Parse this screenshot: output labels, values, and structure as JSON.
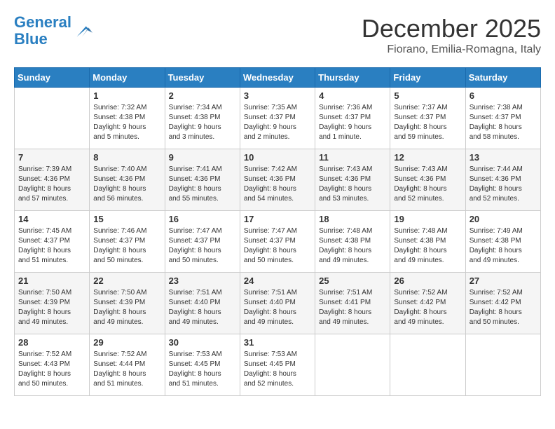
{
  "logo": {
    "line1": "General",
    "line2": "Blue"
  },
  "title": "December 2025",
  "location": "Fiorano, Emilia-Romagna, Italy",
  "header_days": [
    "Sunday",
    "Monday",
    "Tuesday",
    "Wednesday",
    "Thursday",
    "Friday",
    "Saturday"
  ],
  "weeks": [
    [
      {
        "day": "",
        "info": ""
      },
      {
        "day": "1",
        "info": "Sunrise: 7:32 AM\nSunset: 4:38 PM\nDaylight: 9 hours\nand 5 minutes."
      },
      {
        "day": "2",
        "info": "Sunrise: 7:34 AM\nSunset: 4:38 PM\nDaylight: 9 hours\nand 3 minutes."
      },
      {
        "day": "3",
        "info": "Sunrise: 7:35 AM\nSunset: 4:37 PM\nDaylight: 9 hours\nand 2 minutes."
      },
      {
        "day": "4",
        "info": "Sunrise: 7:36 AM\nSunset: 4:37 PM\nDaylight: 9 hours\nand 1 minute."
      },
      {
        "day": "5",
        "info": "Sunrise: 7:37 AM\nSunset: 4:37 PM\nDaylight: 8 hours\nand 59 minutes."
      },
      {
        "day": "6",
        "info": "Sunrise: 7:38 AM\nSunset: 4:37 PM\nDaylight: 8 hours\nand 58 minutes."
      }
    ],
    [
      {
        "day": "7",
        "info": "Sunrise: 7:39 AM\nSunset: 4:36 PM\nDaylight: 8 hours\nand 57 minutes."
      },
      {
        "day": "8",
        "info": "Sunrise: 7:40 AM\nSunset: 4:36 PM\nDaylight: 8 hours\nand 56 minutes."
      },
      {
        "day": "9",
        "info": "Sunrise: 7:41 AM\nSunset: 4:36 PM\nDaylight: 8 hours\nand 55 minutes."
      },
      {
        "day": "10",
        "info": "Sunrise: 7:42 AM\nSunset: 4:36 PM\nDaylight: 8 hours\nand 54 minutes."
      },
      {
        "day": "11",
        "info": "Sunrise: 7:43 AM\nSunset: 4:36 PM\nDaylight: 8 hours\nand 53 minutes."
      },
      {
        "day": "12",
        "info": "Sunrise: 7:43 AM\nSunset: 4:36 PM\nDaylight: 8 hours\nand 52 minutes."
      },
      {
        "day": "13",
        "info": "Sunrise: 7:44 AM\nSunset: 4:36 PM\nDaylight: 8 hours\nand 52 minutes."
      }
    ],
    [
      {
        "day": "14",
        "info": "Sunrise: 7:45 AM\nSunset: 4:37 PM\nDaylight: 8 hours\nand 51 minutes."
      },
      {
        "day": "15",
        "info": "Sunrise: 7:46 AM\nSunset: 4:37 PM\nDaylight: 8 hours\nand 50 minutes."
      },
      {
        "day": "16",
        "info": "Sunrise: 7:47 AM\nSunset: 4:37 PM\nDaylight: 8 hours\nand 50 minutes."
      },
      {
        "day": "17",
        "info": "Sunrise: 7:47 AM\nSunset: 4:37 PM\nDaylight: 8 hours\nand 50 minutes."
      },
      {
        "day": "18",
        "info": "Sunrise: 7:48 AM\nSunset: 4:38 PM\nDaylight: 8 hours\nand 49 minutes."
      },
      {
        "day": "19",
        "info": "Sunrise: 7:48 AM\nSunset: 4:38 PM\nDaylight: 8 hours\nand 49 minutes."
      },
      {
        "day": "20",
        "info": "Sunrise: 7:49 AM\nSunset: 4:38 PM\nDaylight: 8 hours\nand 49 minutes."
      }
    ],
    [
      {
        "day": "21",
        "info": "Sunrise: 7:50 AM\nSunset: 4:39 PM\nDaylight: 8 hours\nand 49 minutes."
      },
      {
        "day": "22",
        "info": "Sunrise: 7:50 AM\nSunset: 4:39 PM\nDaylight: 8 hours\nand 49 minutes."
      },
      {
        "day": "23",
        "info": "Sunrise: 7:51 AM\nSunset: 4:40 PM\nDaylight: 8 hours\nand 49 minutes."
      },
      {
        "day": "24",
        "info": "Sunrise: 7:51 AM\nSunset: 4:40 PM\nDaylight: 8 hours\nand 49 minutes."
      },
      {
        "day": "25",
        "info": "Sunrise: 7:51 AM\nSunset: 4:41 PM\nDaylight: 8 hours\nand 49 minutes."
      },
      {
        "day": "26",
        "info": "Sunrise: 7:52 AM\nSunset: 4:42 PM\nDaylight: 8 hours\nand 49 minutes."
      },
      {
        "day": "27",
        "info": "Sunrise: 7:52 AM\nSunset: 4:42 PM\nDaylight: 8 hours\nand 50 minutes."
      }
    ],
    [
      {
        "day": "28",
        "info": "Sunrise: 7:52 AM\nSunset: 4:43 PM\nDaylight: 8 hours\nand 50 minutes."
      },
      {
        "day": "29",
        "info": "Sunrise: 7:52 AM\nSunset: 4:44 PM\nDaylight: 8 hours\nand 51 minutes."
      },
      {
        "day": "30",
        "info": "Sunrise: 7:53 AM\nSunset: 4:45 PM\nDaylight: 8 hours\nand 51 minutes."
      },
      {
        "day": "31",
        "info": "Sunrise: 7:53 AM\nSunset: 4:45 PM\nDaylight: 8 hours\nand 52 minutes."
      },
      {
        "day": "",
        "info": ""
      },
      {
        "day": "",
        "info": ""
      },
      {
        "day": "",
        "info": ""
      }
    ]
  ]
}
